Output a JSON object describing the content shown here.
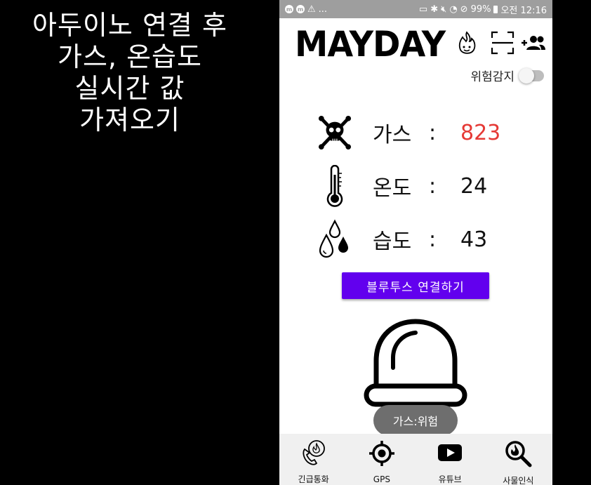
{
  "caption": {
    "lines": [
      "아두이노 연결 후",
      "가스, 온습도",
      "실시간 값",
      "가져오기"
    ]
  },
  "statusbar": {
    "battery": "99%",
    "time": "오전 12:16",
    "ellipsis": "..."
  },
  "app": {
    "title": "MAYDAY",
    "danger_label": "위험감지",
    "danger_enabled": false
  },
  "sensors": [
    {
      "label": "가스",
      "colon": ":",
      "value": "823",
      "value_color": "#e53935"
    },
    {
      "label": "온도",
      "colon": ":",
      "value": "24",
      "value_color": "#111111"
    },
    {
      "label": "습도",
      "colon": ":",
      "value": "43",
      "value_color": "#111111"
    }
  ],
  "bluetooth_button": "블루투스 연결하기",
  "toast": "가스:위험",
  "accent_color": "#6200ee",
  "bottom_nav": [
    {
      "label": "긴급통화",
      "icon": "emergency-call-icon"
    },
    {
      "label": "GPS",
      "icon": "gps-target-icon"
    },
    {
      "label": "유튜브",
      "icon": "youtube-play-icon"
    },
    {
      "label": "사물인식",
      "icon": "fire-search-icon"
    }
  ]
}
